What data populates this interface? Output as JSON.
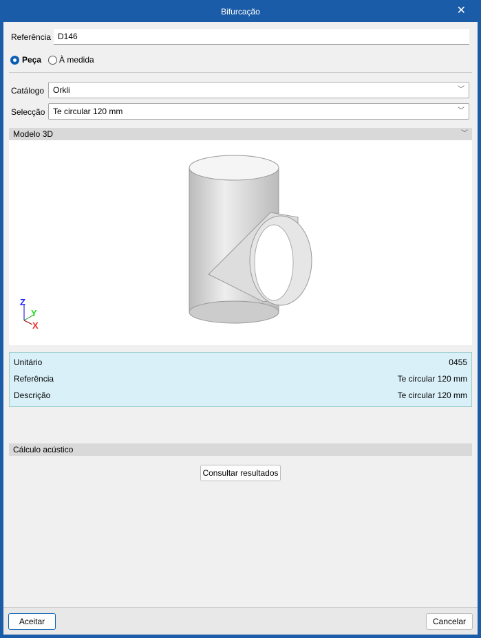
{
  "window": {
    "title": "Bifurcação"
  },
  "form": {
    "reference_label": "Referência",
    "reference_value": "D146",
    "radio_piece": "Peça",
    "radio_custom": "À medida",
    "catalog_label": "Catálogo",
    "catalog_value": "Orkli",
    "selection_label": "Selecção",
    "selection_value": "Te circular 120 mm"
  },
  "model": {
    "header": "Modelo 3D",
    "axes": {
      "z": "Z",
      "y": "Y",
      "x": "X"
    }
  },
  "info": [
    {
      "label": "Unitário",
      "value": "0455"
    },
    {
      "label": "Referência",
      "value": "Te circular 120 mm"
    },
    {
      "label": "Descrição",
      "value": "Te circular 120 mm"
    }
  ],
  "acoustic": {
    "header": "Cálculo acústico",
    "button": "Consultar resultados"
  },
  "footer": {
    "accept": "Aceitar",
    "cancel": "Cancelar"
  },
  "colors": {
    "titlebar": "#1a5ca8",
    "accent": "#0a5fb4"
  }
}
